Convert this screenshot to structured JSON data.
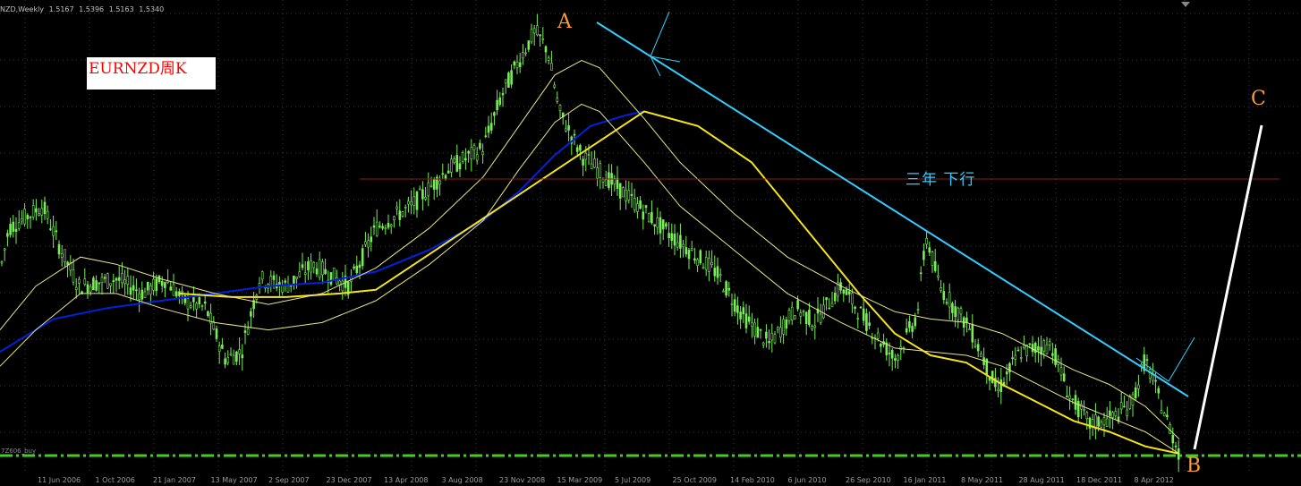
{
  "header": {
    "symbol": "NZD,Weekly",
    "open": "1.5167",
    "high": "1.5396",
    "low": "1.5163",
    "close": "1.5340"
  },
  "indicator_label": "7Z606_buy",
  "annotations": {
    "pair_label": "EURNZD周K",
    "point_a": "A",
    "point_b": "B",
    "point_c": "C",
    "trend_note": "三年 下行"
  },
  "colors": {
    "background": "#000000",
    "grid": "#3a3a3a",
    "candle": "#77ee55",
    "ma_blue": "#0022dd",
    "ma_yellow": "#f5e31c",
    "envelope": "#e9e58c",
    "trend_line": "#33ccff",
    "horizontal_line": "#8b1a1a",
    "support_line": "#44cc22",
    "abc_letters": "#ff9933",
    "projection": "#ffffff"
  },
  "chart_data": {
    "type": "candlestick",
    "title": "",
    "xlabel": "",
    "ylabel": "",
    "grid": true,
    "x_ticks": [
      "11 Jun 2006",
      "1 Oct 2006",
      "21 Jan 2007",
      "13 May 2007",
      "2 Sep 2007",
      "23 Dec 2007",
      "13 Apr 2008",
      "3 Aug 2008",
      "23 Nov 2008",
      "15 Mar 2009",
      "5 Jul 2009",
      "25 Oct 2009",
      "14 Feb 2010",
      "6 Jun 2010",
      "26 Sep 2010",
      "16 Jan 2011",
      "8 May 2011",
      "28 Aug 2011",
      "18 Dec 2011",
      "8 Apr 2012"
    ],
    "price_path": [
      [
        0,
        0.34
      ],
      [
        10,
        0.46
      ],
      [
        48,
        0.52
      ],
      [
        68,
        0.4
      ],
      [
        88,
        0.3
      ],
      [
        130,
        0.32
      ],
      [
        160,
        0.28
      ],
      [
        185,
        0.32
      ],
      [
        205,
        0.26
      ],
      [
        230,
        0.24
      ],
      [
        252,
        0.1
      ],
      [
        270,
        0.12
      ],
      [
        290,
        0.32
      ],
      [
        320,
        0.3
      ],
      [
        350,
        0.36
      ],
      [
        390,
        0.3
      ],
      [
        420,
        0.46
      ],
      [
        460,
        0.52
      ],
      [
        500,
        0.62
      ],
      [
        540,
        0.68
      ],
      [
        560,
        0.82
      ],
      [
        580,
        0.92
      ],
      [
        598,
        1.0
      ],
      [
        612,
        0.95
      ],
      [
        625,
        0.78
      ],
      [
        650,
        0.66
      ],
      [
        700,
        0.55
      ],
      [
        745,
        0.45
      ],
      [
        770,
        0.4
      ],
      [
        800,
        0.34
      ],
      [
        830,
        0.22
      ],
      [
        860,
        0.14
      ],
      [
        890,
        0.24
      ],
      [
        910,
        0.2
      ],
      [
        940,
        0.3
      ],
      [
        975,
        0.18
      ],
      [
        1000,
        0.1
      ],
      [
        1025,
        0.22
      ],
      [
        1035,
        0.44
      ],
      [
        1050,
        0.3
      ],
      [
        1085,
        0.18
      ],
      [
        1115,
        0.01
      ],
      [
        1140,
        0.12
      ],
      [
        1175,
        0.14
      ],
      [
        1195,
        0.0
      ],
      [
        1218,
        -0.08
      ],
      [
        1245,
        -0.06
      ],
      [
        1265,
        -0.02
      ],
      [
        1280,
        0.1
      ],
      [
        1300,
        -0.04
      ],
      [
        1318,
        -0.16
      ]
    ],
    "series": [
      {
        "name": "",
        "color": "#0022dd",
        "points": [
          [
            0,
            0.12
          ],
          [
            60,
            0.21
          ],
          [
            120,
            0.24
          ],
          [
            180,
            0.26
          ],
          [
            240,
            0.28
          ],
          [
            300,
            0.3
          ],
          [
            360,
            0.31
          ],
          [
            420,
            0.34
          ],
          [
            480,
            0.4
          ],
          [
            540,
            0.48
          ],
          [
            580,
            0.56
          ],
          [
            620,
            0.66
          ],
          [
            660,
            0.74
          ],
          [
            700,
            0.77
          ],
          [
            720,
            0.78
          ]
        ]
      },
      {
        "name": "",
        "color": "#f5e31c",
        "points": [
          [
            200,
            0.28
          ],
          [
            260,
            0.27
          ],
          [
            320,
            0.27
          ],
          [
            380,
            0.28
          ],
          [
            420,
            0.29
          ],
          [
            720,
            0.78
          ],
          [
            780,
            0.74
          ],
          [
            840,
            0.64
          ],
          [
            880,
            0.52
          ],
          [
            920,
            0.4
          ],
          [
            960,
            0.28
          ],
          [
            1000,
            0.17
          ],
          [
            1040,
            0.11
          ],
          [
            1080,
            0.09
          ],
          [
            1120,
            0.03
          ],
          [
            1160,
            -0.02
          ],
          [
            1200,
            -0.07
          ],
          [
            1240,
            -0.1
          ],
          [
            1280,
            -0.14
          ],
          [
            1318,
            -0.16
          ]
        ]
      },
      {
        "name": "",
        "color": "#e9e58c",
        "points": [
          [
            0,
            0.18
          ],
          [
            40,
            0.3
          ],
          [
            90,
            0.38
          ],
          [
            130,
            0.36
          ],
          [
            180,
            0.32
          ],
          [
            240,
            0.28
          ],
          [
            300,
            0.25
          ],
          [
            360,
            0.28
          ],
          [
            420,
            0.35
          ],
          [
            480,
            0.46
          ],
          [
            540,
            0.6
          ],
          [
            580,
            0.74
          ],
          [
            620,
            0.88
          ],
          [
            650,
            0.92
          ],
          [
            670,
            0.9
          ],
          [
            720,
            0.76
          ],
          [
            760,
            0.64
          ],
          [
            820,
            0.5
          ],
          [
            880,
            0.38
          ],
          [
            940,
            0.3
          ],
          [
            1000,
            0.23
          ],
          [
            1040,
            0.21
          ],
          [
            1080,
            0.2
          ],
          [
            1120,
            0.17
          ],
          [
            1160,
            0.12
          ],
          [
            1200,
            0.07
          ],
          [
            1240,
            0.03
          ],
          [
            1280,
            -0.03
          ],
          [
            1318,
            -0.12
          ]
        ]
      },
      {
        "name": "",
        "color": "#e9e58c",
        "points": [
          [
            0,
            0.08
          ],
          [
            40,
            0.18
          ],
          [
            90,
            0.28
          ],
          [
            130,
            0.28
          ],
          [
            180,
            0.24
          ],
          [
            240,
            0.2
          ],
          [
            300,
            0.18
          ],
          [
            360,
            0.2
          ],
          [
            420,
            0.26
          ],
          [
            480,
            0.36
          ],
          [
            540,
            0.48
          ],
          [
            580,
            0.62
          ],
          [
            620,
            0.75
          ],
          [
            650,
            0.8
          ],
          [
            670,
            0.78
          ],
          [
            720,
            0.64
          ],
          [
            760,
            0.52
          ],
          [
            820,
            0.4
          ],
          [
            880,
            0.28
          ],
          [
            940,
            0.2
          ],
          [
            1000,
            0.13
          ],
          [
            1040,
            0.12
          ],
          [
            1080,
            0.11
          ],
          [
            1120,
            0.08
          ],
          [
            1160,
            0.03
          ],
          [
            1200,
            -0.02
          ],
          [
            1240,
            -0.06
          ],
          [
            1280,
            -0.1
          ],
          [
            1318,
            -0.16
          ]
        ]
      }
    ]
  }
}
